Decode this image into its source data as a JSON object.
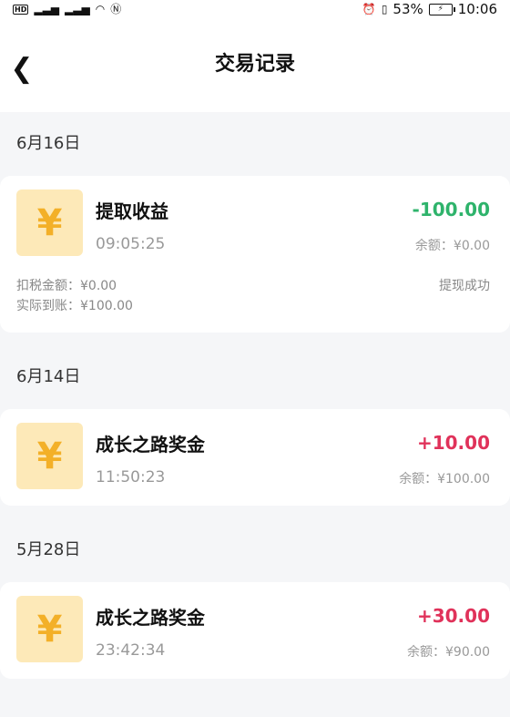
{
  "status_bar": {
    "signal_left": "HD 4G .ıll 5G .ıll",
    "battery_percent": "53%",
    "time": "10:06"
  },
  "header": {
    "back_glyph": "❮",
    "title": "交易记录"
  },
  "groups": [
    {
      "date": "6月16日",
      "name": "提取收益",
      "time": "09:05:25",
      "amount": "-100.00",
      "balance": "余额：¥0.00",
      "tax": "扣税金额：¥0.00",
      "actual": "实际到账：¥100.00",
      "status": "提现成功"
    },
    {
      "date": "6月14日",
      "name": "成长之路奖金",
      "time": "11:50:23",
      "amount": "+10.00",
      "balance": "余额：¥100.00"
    },
    {
      "date": "5月28日",
      "name": "成长之路奖金",
      "time": "23:42:34",
      "amount": "+30.00",
      "balance": "余额：¥90.00"
    }
  ],
  "coin_glyph": "¥",
  "colors": {
    "negative_amount": "#2eb36b",
    "positive_amount": "#e0325a",
    "coin_bg": "#fde9b8",
    "coin_fg": "#f3b028"
  }
}
